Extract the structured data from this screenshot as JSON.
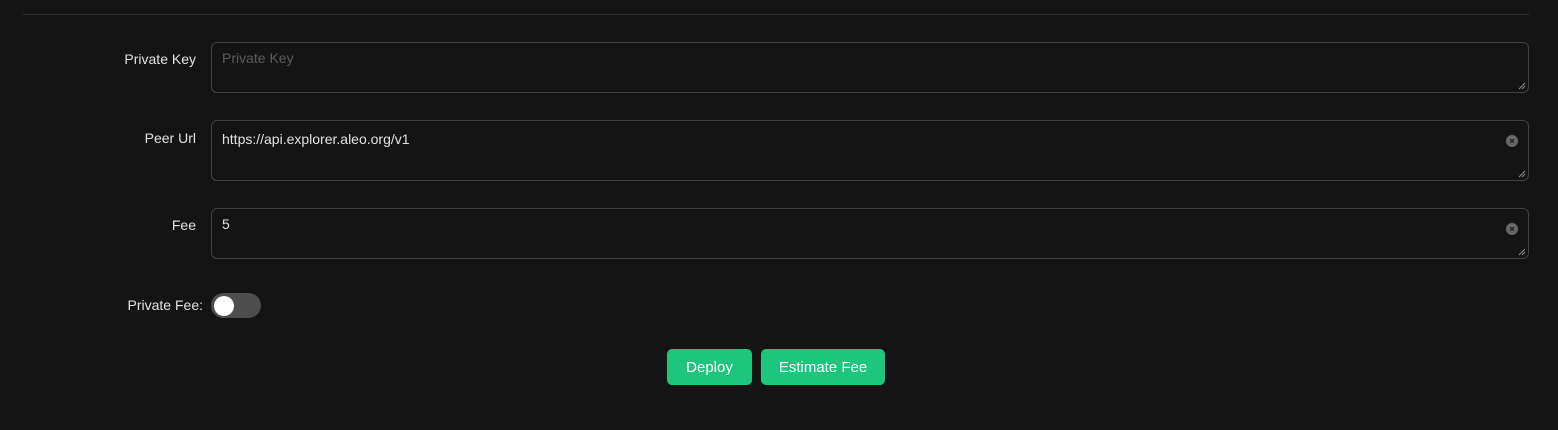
{
  "form": {
    "private_key": {
      "label": "Private Key",
      "value": "",
      "placeholder": "Private Key"
    },
    "peer_url": {
      "label": "Peer Url",
      "value": "https://api.explorer.aleo.org/v1"
    },
    "fee": {
      "label": "Fee",
      "value": "5"
    },
    "private_fee": {
      "label": "Private Fee",
      "enabled": false
    }
  },
  "actions": {
    "deploy_label": "Deploy",
    "estimate_fee_label": "Estimate Fee"
  },
  "colors": {
    "background": "#141414",
    "accent": "#1ec57c",
    "border": "#424242",
    "switch_off": "#4d4d4d"
  }
}
